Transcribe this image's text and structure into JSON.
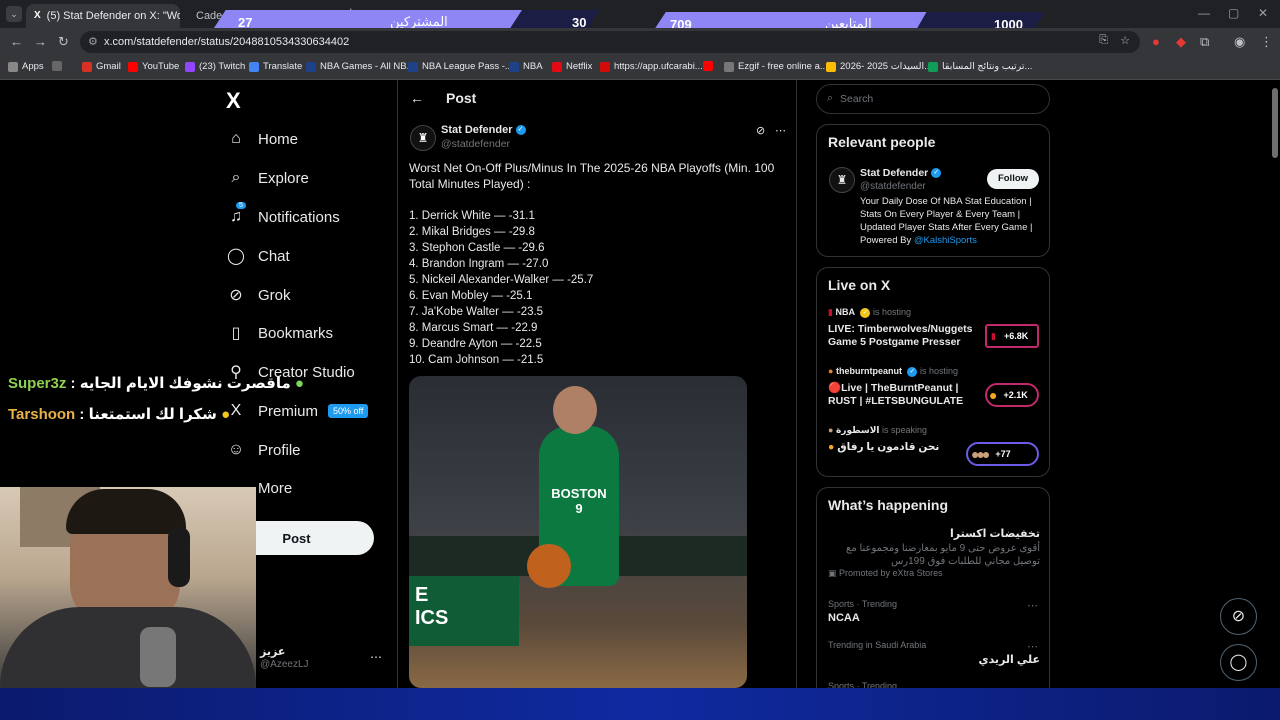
{
  "browser": {
    "tabs": [
      {
        "label": "(5) Stat Defender on X: \"Worst N"
      },
      {
        "label": "Cade Cunningham Stats, Height,"
      }
    ],
    "url": "x.com/statdefender/status/2048810534330634402",
    "bookmarks": [
      "Apps",
      "Gmail",
      "YouTube",
      "(23) Twitch",
      "Translate",
      "NBA Games - All NB...",
      "NBA League Pass -...",
      "NBA",
      "Netflix",
      "https://app.ufcarabi...",
      "Ezgif - free online a...",
      "السيدات 2025 -2026...",
      "ترتيب ونتائج المسابقا..."
    ]
  },
  "stream_overlay": {
    "subs_count": "27",
    "subs_label": "المشتركين",
    "subs_goal": "30",
    "followers_count": "709",
    "followers_label": "المتابعين",
    "followers_goal": "1000"
  },
  "x_nav": {
    "logo": "X",
    "items": [
      "Home",
      "Explore",
      "Notifications",
      "Chat",
      "Grok",
      "Bookmarks",
      "Creator Studio",
      "Premium",
      "Profile",
      "More"
    ],
    "notif_badge": "5",
    "premium_badge": "50% off",
    "post_button": "Post",
    "account_name": "عزيز",
    "account_handle": "@AzeezLJ"
  },
  "post": {
    "header_title": "Post",
    "author_name": "Stat Defender",
    "author_handle": "@statdefender",
    "intro": "Worst Net On-Off Plus/Minus In The 2025-26 NBA Playoffs (Min. 100 Total Minutes Played) :",
    "list": [
      "1.  Derrick White  —  -31.1",
      "2.  Mikal Bridges  —  -29.8",
      "3.  Stephon Castle  —  -29.6",
      "4.  Brandon Ingram  —  -27.0",
      "5.  Nickeil Alexander-Walker  —  -25.7",
      "6.  Evan Mobley  —  -25.1",
      "7.  Ja'Kobe Walter  —  -23.5",
      "8.  Marcus Smart  —  -22.9",
      "9.  Deandre Ayton  —  -22.5",
      "10.  Cam Johnson  —  -21.5"
    ]
  },
  "right": {
    "search_placeholder": "Search",
    "relevant_title": "Relevant people",
    "rel_name": "Stat Defender",
    "rel_handle": "@statdefender",
    "follow_label": "Follow",
    "bio": "Your Daily Dose Of NBA Stat Education | Stats On Every Player & Every Team | Updated Player Stats After Every Game | Powered By",
    "bio_link": "@KalshiSports",
    "live_title": "Live on X",
    "live": [
      {
        "host": "NBA",
        "status": "is hosting",
        "title": "LIVE: Timberwolves/Nuggets Game 5 Postgame Presser",
        "count": "+6.8K"
      },
      {
        "host": "theburntpeanut",
        "status": "is hosting",
        "title": "🔴Live | TheBurntPeanut | RUST | #LETSBUNGULATE",
        "count": "+2.1K"
      },
      {
        "host": "الاسطورة",
        "status": "is speaking",
        "title": "نحن قادمون يا رفاق",
        "count": "+77"
      }
    ],
    "happening_title": "What’s happening",
    "trends": [
      {
        "meta": "",
        "title": "تخفيضات اكسترا",
        "desc": "أقوى عروض حتى 9 مايو بمعارضنا ومجموعنا مع توصيل مجاني للطلبات فوق 199رس",
        "promo": "Promoted by eXtra Stores"
      },
      {
        "meta": "Sports · Trending",
        "title": "NCAA"
      },
      {
        "meta": "Trending in Saudi Arabia",
        "title": "علي الريدي"
      },
      {
        "meta": "Sports · Trending",
        "title": ""
      }
    ]
  },
  "chat": [
    {
      "user": "Super3z",
      "text": "ماقصرت نشوفك الايام الجايه"
    },
    {
      "user": "Tarshoon",
      "text": "شكرا لك استمتعنا"
    }
  ],
  "colors": {
    "x_blue": "#1d9bf0",
    "overlay_purple": "#8f86f5",
    "overlay_dark": "#1b1d44"
  }
}
